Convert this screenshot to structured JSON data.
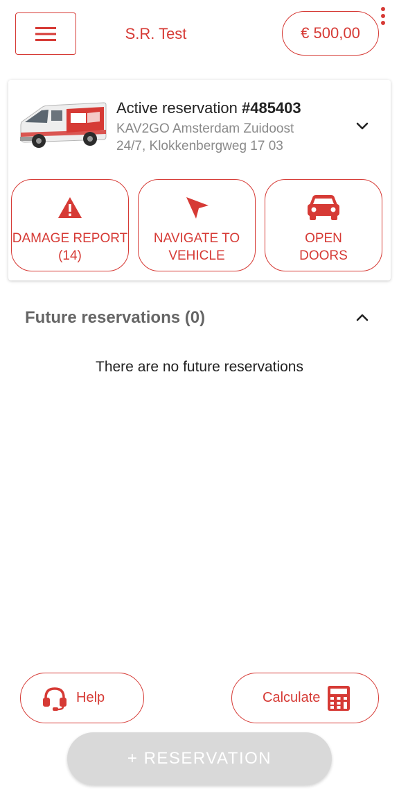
{
  "header": {
    "user_name": "S.R. Test",
    "balance": "€ 500,00"
  },
  "active_reservation": {
    "title_prefix": "Active reservation",
    "number": "#485403",
    "location": "KAV2GO Amsterdam Zuidoost",
    "address": "24/7, Klokkenbergweg 17 03",
    "actions": [
      {
        "line1": "DAMAGE REPORT",
        "line2": "(14)",
        "icon": "warning-icon"
      },
      {
        "line1": "NAVIGATE TO",
        "line2": "VEHICLE",
        "icon": "navigation-arrow-icon"
      },
      {
        "line1": "OPEN",
        "line2": "DOORS",
        "icon": "car-icon"
      }
    ]
  },
  "future": {
    "title": "Future reservations (0)",
    "empty_message": "There are no future reservations"
  },
  "bottom": {
    "help_label": "Help",
    "calculate_label": "Calculate",
    "new_reservation_label": "+ RESERVATION"
  },
  "colors": {
    "accent": "#d63a35",
    "disabled_button": "#d9d9d9"
  }
}
